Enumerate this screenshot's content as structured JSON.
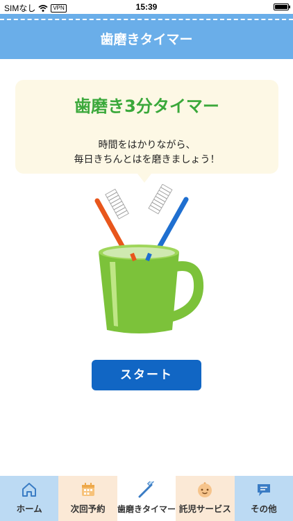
{
  "status_bar": {
    "carrier": "SIMなし",
    "vpn": "VPN",
    "time": "15:39"
  },
  "header": {
    "title": "歯磨きタイマー"
  },
  "bubble": {
    "title": "歯磨き3分タイマー",
    "line1": "時間をはかりながら、",
    "line2": "毎日きちんとはを磨きましょう！"
  },
  "start_button": {
    "label": "スタート"
  },
  "tabs": [
    {
      "label": "ホーム",
      "icon": "house-icon",
      "selected": false
    },
    {
      "label": "次回予約",
      "icon": "calendar-icon",
      "selected": false
    },
    {
      "label": "歯磨きタイマー",
      "icon": "toothbrush-icon",
      "selected": true
    },
    {
      "label": "託児サービス",
      "icon": "baby-face-icon",
      "selected": false
    },
    {
      "label": "その他",
      "icon": "chat-bubble-icon",
      "selected": false
    }
  ],
  "colors": {
    "header": "#6aaee9",
    "bubble": "#fdf8e5",
    "title_green": "#3aa83a",
    "start_button": "#1166c4",
    "tab_blue": "#bcdaf3",
    "tab_peach": "#fbe9d6"
  }
}
